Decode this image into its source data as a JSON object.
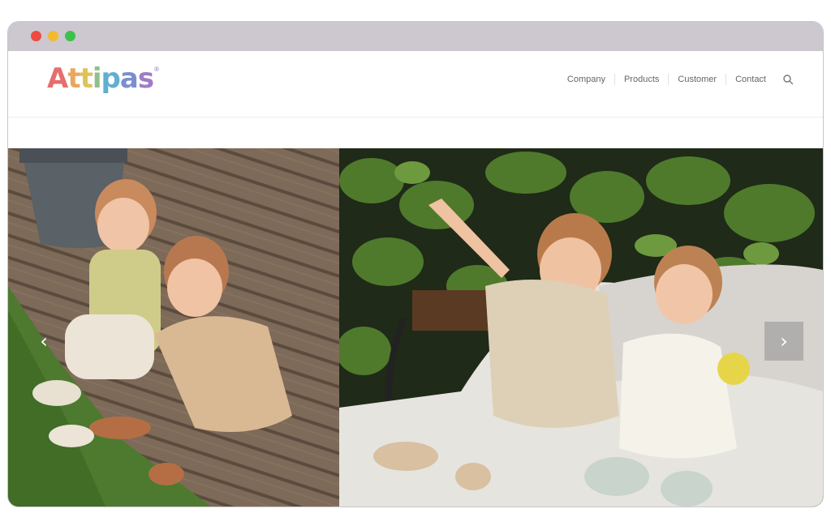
{
  "browser": {
    "buttons": [
      "close",
      "minimize",
      "maximize"
    ]
  },
  "header": {
    "logo": {
      "letters": [
        "A",
        "t",
        "t",
        "i",
        "p",
        "a",
        "s"
      ],
      "registered": "®",
      "colors": [
        "#e56e6e",
        "#e9a75f",
        "#e9c85a",
        "#8fc08b",
        "#5fb0d2",
        "#7a8fcf",
        "#a07cc5"
      ]
    },
    "nav": {
      "items": [
        "Company",
        "Products",
        "Customer",
        "Contact"
      ],
      "search_icon": "search-icon"
    }
  },
  "hero": {
    "slides": [
      {
        "description": "two toddlers sitting on a wooden deck beside grass and a grey planter"
      },
      {
        "description": "two toddlers sitting on a white blanket on a garden bench in front of green leaves"
      }
    ],
    "controls": {
      "prev": "‹",
      "next": "›"
    }
  }
}
